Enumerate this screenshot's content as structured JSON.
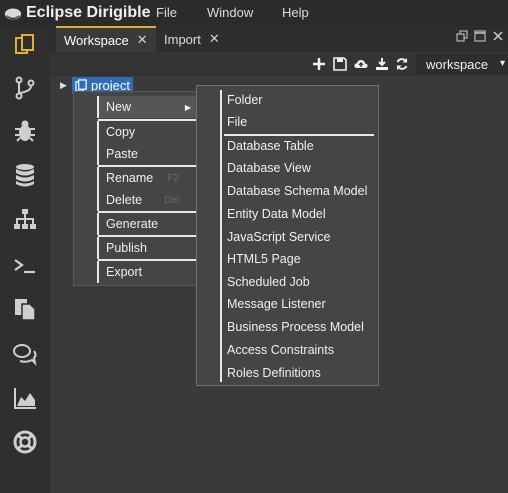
{
  "app": {
    "title": "Eclipse Dirigible"
  },
  "menubar": [
    "File",
    "Window",
    "Help"
  ],
  "sidebar": {
    "icons": [
      "workspace-icon",
      "git-branch-icon",
      "debug-bug-icon",
      "database-icon",
      "hierarchy-icon",
      "terminal-icon",
      "documents-icon",
      "comments-icon",
      "area-chart-icon",
      "lifebuoy-icon"
    ]
  },
  "tabs": [
    {
      "label": "Workspace",
      "close": "✕",
      "active": true
    },
    {
      "label": "Import",
      "close": "✕",
      "active": false
    }
  ],
  "window_controls": [
    "restore-icon",
    "maximize-icon",
    "close-icon"
  ],
  "toolbar": {
    "buttons": [
      "new-plus-icon",
      "save-icon",
      "upload-cloud-icon",
      "download-icon",
      "refresh-icon"
    ],
    "workspace_select": {
      "value": "workspace",
      "caret": "▾"
    }
  },
  "tree": {
    "toggle": "▶",
    "node_label": "project"
  },
  "context_menu": {
    "items": [
      {
        "label": "New",
        "has_submenu": true
      },
      {
        "label": "Copy"
      },
      {
        "label": "Paste"
      },
      {
        "label": "Rename",
        "shortcut": "F2"
      },
      {
        "label": "Delete",
        "shortcut": "Del"
      },
      {
        "label": "Generate"
      },
      {
        "label": "Publish"
      },
      {
        "label": "Export"
      }
    ]
  },
  "submenu": {
    "items": [
      "Folder",
      "File",
      "Database Table",
      "Database View",
      "Database Schema Model",
      "Entity Data Model",
      "JavaScript Service",
      "HTML5 Page",
      "Scheduled Job",
      "Message Listener",
      "Business Process Model",
      "Access Constraints",
      "Roles Definitions"
    ]
  },
  "colors": {
    "accent": "#e0b035",
    "selection": "#2e6db8",
    "background": "#3a3a3a"
  }
}
